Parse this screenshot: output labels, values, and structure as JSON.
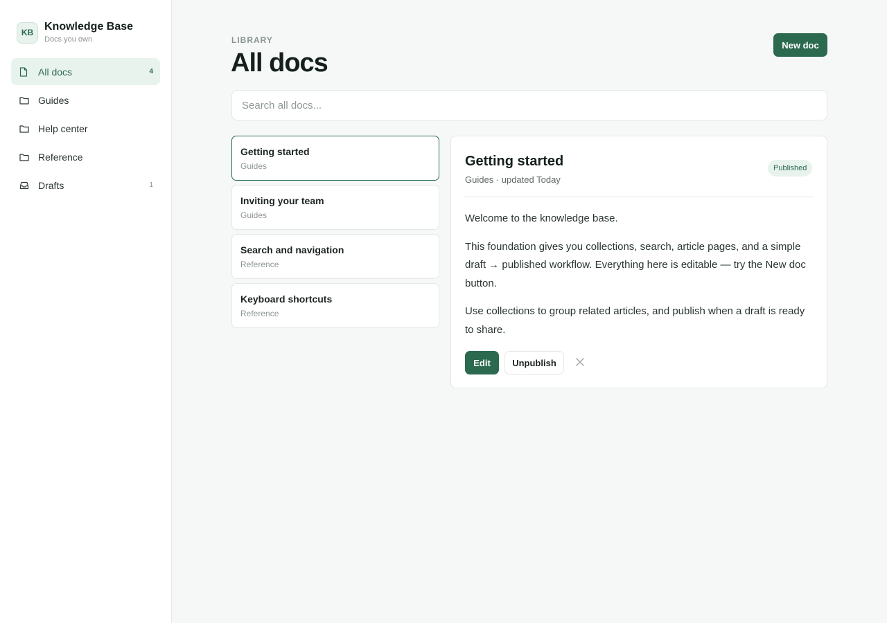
{
  "brand": {
    "logo_text": "KB",
    "title": "Knowledge Base",
    "subtitle": "Docs you own"
  },
  "sidebar": {
    "items": [
      {
        "label": "All docs",
        "count": "4",
        "icon": "file-icon",
        "active": true
      },
      {
        "label": "Guides",
        "count": "",
        "icon": "folder-icon"
      },
      {
        "label": "Help center",
        "count": "",
        "icon": "folder-icon"
      },
      {
        "label": "Reference",
        "count": "",
        "icon": "folder-icon"
      },
      {
        "label": "Drafts",
        "count": "1",
        "icon": "inbox-icon"
      }
    ]
  },
  "header": {
    "eyebrow": "LIBRARY",
    "title": "All docs",
    "new_doc_label": "New doc"
  },
  "search": {
    "placeholder": "Search all docs..."
  },
  "docs": [
    {
      "title": "Getting started",
      "collection": "Guides",
      "selected": true
    },
    {
      "title": "Inviting your team",
      "collection": "Guides"
    },
    {
      "title": "Search and navigation",
      "collection": "Reference"
    },
    {
      "title": "Keyboard shortcuts",
      "collection": "Reference"
    }
  ],
  "article": {
    "title": "Getting started",
    "meta": "Guides · updated Today",
    "status": "Published",
    "paragraphs": [
      "Welcome to the knowledge base.",
      "This foundation gives you collections, search, article pages, and a simple draft → published workflow. Everything here is editable — try the New doc button.",
      "Use collections to group related articles, and publish when a draft is ready to share."
    ],
    "edit_label": "Edit",
    "unpublish_label": "Unpublish"
  },
  "colors": {
    "accent": "#2b6a4f",
    "accent_soft": "#e9f3ee",
    "background": "#f6f8f7"
  }
}
